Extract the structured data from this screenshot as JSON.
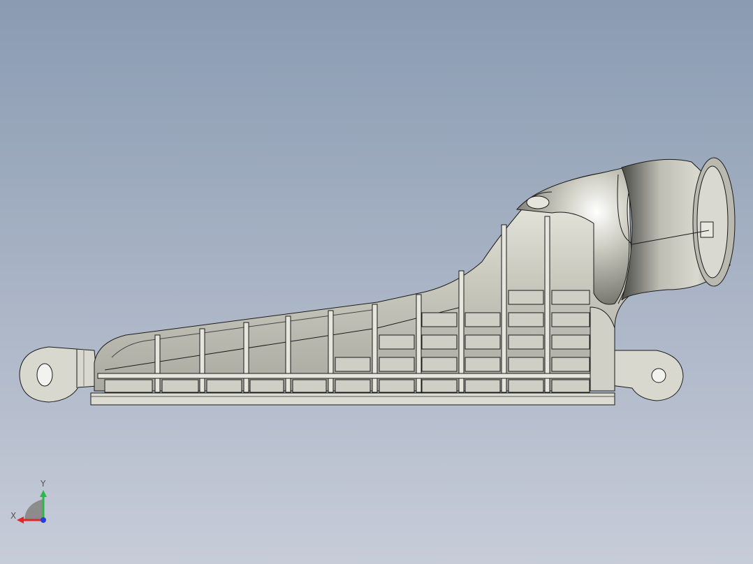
{
  "viewport": {
    "background_top": "#8a9bb2",
    "background_bottom": "#c7ccd8"
  },
  "model": {
    "fill_light": "#dcdcd2",
    "fill_mid": "#c8c8bc",
    "fill_dark": "#9a9a92",
    "edge": "#1a1a1a"
  },
  "triad": {
    "x_label": "X",
    "y_label": "Y",
    "x_color": "#e0262a",
    "y_color": "#2bb84a",
    "z_color": "#2a3bd6"
  }
}
